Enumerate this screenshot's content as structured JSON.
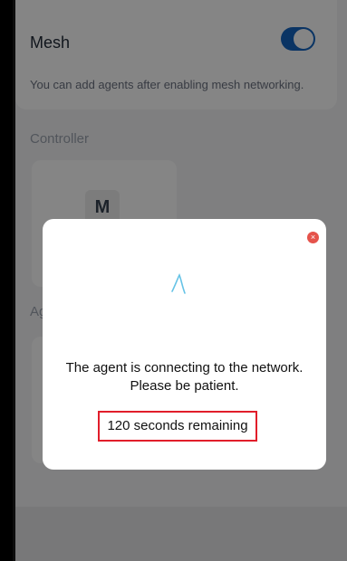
{
  "mesh": {
    "title": "Mesh",
    "description": "You can add agents after enabling mesh networking.",
    "enabled": true,
    "toggle_color": "#1565c0"
  },
  "controller": {
    "section_label": "Controller",
    "device_letter": "M"
  },
  "agents": {
    "section_label_partial": "Ag"
  },
  "dialog": {
    "close_icon": "close-icon",
    "close_glyph": "×",
    "spinner_icon": "loading-spinner-icon",
    "message_line1": "The agent is connecting to the network.",
    "message_line2": "Please be patient.",
    "countdown_text": "120 seconds remaining",
    "highlight_color": "#e11d2a",
    "close_color": "#e5534b"
  }
}
